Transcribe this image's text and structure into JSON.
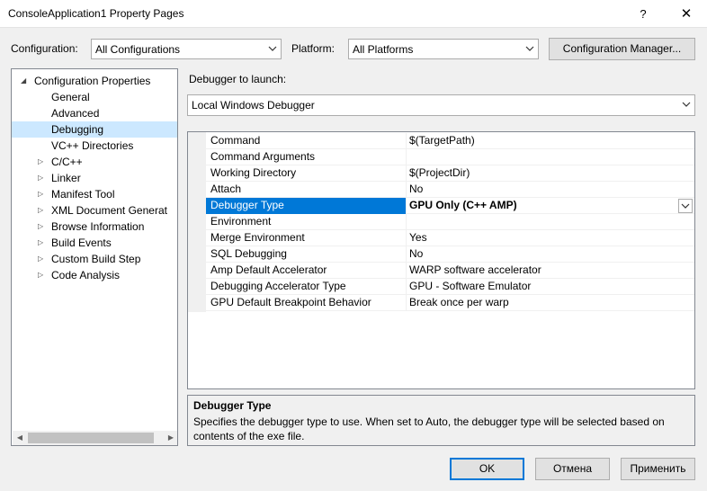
{
  "window": {
    "title": "ConsoleApplication1 Property Pages",
    "help_glyph": "?",
    "close_glyph": "✕"
  },
  "toolbar": {
    "configuration_label": "Configuration:",
    "configuration_value": "All Configurations",
    "platform_label": "Platform:",
    "platform_value": "All Platforms",
    "config_manager_label": "Configuration Manager..."
  },
  "tree": {
    "items": [
      {
        "label": "Configuration Properties",
        "expander": "◢",
        "level": 0
      },
      {
        "label": "General",
        "expander": "",
        "level": 1
      },
      {
        "label": "Advanced",
        "expander": "",
        "level": 1
      },
      {
        "label": "Debugging",
        "expander": "",
        "level": 1,
        "selected": true
      },
      {
        "label": "VC++ Directories",
        "expander": "",
        "level": 1
      },
      {
        "label": "C/C++",
        "expander": "▷",
        "level": 1
      },
      {
        "label": "Linker",
        "expander": "▷",
        "level": 1
      },
      {
        "label": "Manifest Tool",
        "expander": "▷",
        "level": 1
      },
      {
        "label": "XML Document Generat",
        "expander": "▷",
        "level": 1
      },
      {
        "label": "Browse Information",
        "expander": "▷",
        "level": 1
      },
      {
        "label": "Build Events",
        "expander": "▷",
        "level": 1
      },
      {
        "label": "Custom Build Step",
        "expander": "▷",
        "level": 1
      },
      {
        "label": "Code Analysis",
        "expander": "▷",
        "level": 1
      }
    ],
    "scroll_left_glyph": "◀",
    "scroll_right_glyph": "▶"
  },
  "debugger": {
    "launch_label": "Debugger to launch:",
    "launch_value": "Local Windows Debugger"
  },
  "properties": [
    {
      "name": "Command",
      "value": "$(TargetPath)"
    },
    {
      "name": "Command Arguments",
      "value": ""
    },
    {
      "name": "Working Directory",
      "value": "$(ProjectDir)"
    },
    {
      "name": "Attach",
      "value": "No"
    },
    {
      "name": "Debugger Type",
      "value": "GPU Only (C++ AMP)",
      "selected": true
    },
    {
      "name": "Environment",
      "value": ""
    },
    {
      "name": "Merge Environment",
      "value": "Yes"
    },
    {
      "name": "SQL Debugging",
      "value": "No"
    },
    {
      "name": "Amp Default Accelerator",
      "value": "WARP software accelerator"
    },
    {
      "name": "Debugging Accelerator Type",
      "value": "GPU - Software Emulator"
    },
    {
      "name": "GPU Default Breakpoint Behavior",
      "value": "Break once per warp"
    }
  ],
  "description": {
    "title": "Debugger Type",
    "text": "Specifies the debugger type to use. When set to Auto, the debugger type will be selected based on contents of the exe file."
  },
  "buttons": {
    "ok": "OK",
    "cancel": "Отмена",
    "apply": "Применить"
  },
  "colors": {
    "selection_blue": "#0078d7",
    "tree_selection": "#cce8ff"
  }
}
